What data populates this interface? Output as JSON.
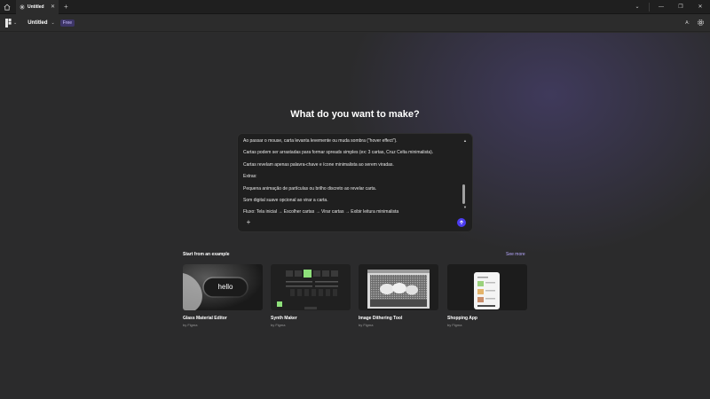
{
  "titlebar": {
    "tab_label": "Untitled",
    "tab_close": "✕",
    "add_tab": "+",
    "minimize": "—",
    "restore": "❐",
    "close": "✕",
    "dropdown": "⌄"
  },
  "toolbar": {
    "logo_chevron": "⌄",
    "file_name": "Untitled",
    "file_chevron": "⌄",
    "plan_badge": "Free",
    "ai_label": "Aː"
  },
  "main": {
    "heading": "What do you want to make?",
    "prompt_lines": [
      "Ao passar o mouse, carta levanta levemente ou muda sombra (\"hover effect\").",
      "Cartas podem ser arrastadas para formar spreads simples (ex: 3 cartas, Cruz Celta minimalista).",
      "Cartas revelam apenas palavra-chave e ícone minimalista ao serem viradas.",
      "Extras:",
      "Pequena animação de partículas ou brilho discreto ao revelar carta.",
      "Som digital suave opcional ao virar a carta.",
      "Fluxo: Tela inicial → Escolher cartas → Virar cartas → Exibir leitura minimalista"
    ],
    "scroll_up": "▲",
    "scroll_down": "▼",
    "plus_label": "+",
    "examples_title": "Start from an example",
    "see_more": "See more",
    "examples": [
      {
        "title": "Glass Material Editor",
        "by": "by Figma",
        "thumb_text": "hello"
      },
      {
        "title": "Synth Maker",
        "by": "by Figma"
      },
      {
        "title": "Image Dithering Tool",
        "by": "by Figma"
      },
      {
        "title": "Shopping App",
        "by": "by Figma"
      }
    ]
  },
  "colors": {
    "accent": "#4c3df0",
    "badge_bg": "#3d3566",
    "link": "#b7a8ff",
    "synth_key": "#8ee07a"
  }
}
